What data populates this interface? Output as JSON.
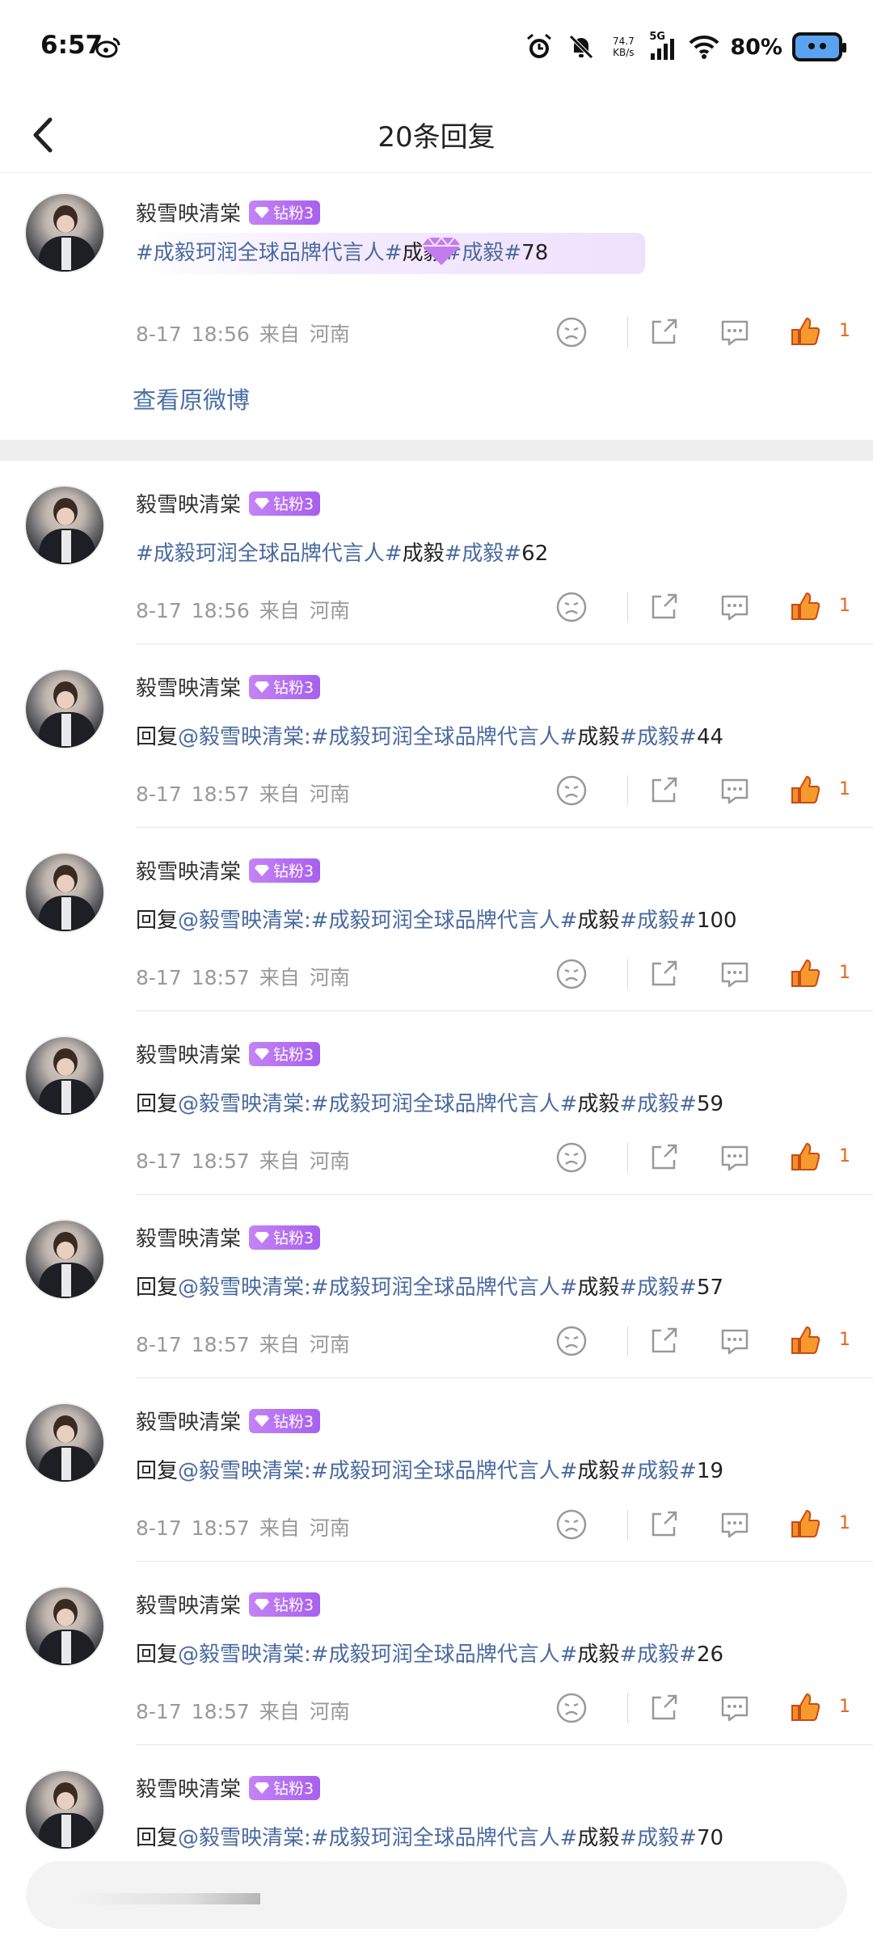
{
  "status_bar": {
    "time": "6:57",
    "net_speed_value": "74.7",
    "net_speed_unit": "KB/s",
    "network": "5G",
    "battery": "80%"
  },
  "header": {
    "title": "20条回复"
  },
  "original": {
    "user": "毅雪映清棠",
    "badge": "钻粉3",
    "tag1": "#成毅珂润全球品牌代言人#",
    "plain1": "成毅",
    "tag2": "#成毅#",
    "plain2": "78",
    "date": "8-17",
    "time": "18:56",
    "from": "来自",
    "location": "河南",
    "likes": "1",
    "view_original": "查看原微博"
  },
  "replies": [
    {
      "user": "毅雪映清棠",
      "badge": "钻粉3",
      "prefix": "",
      "mention": "",
      "tag1": "#成毅珂润全球品牌代言人#",
      "plain1": "成毅",
      "tag2": "#成毅#",
      "plain2": "62",
      "date": "8-17",
      "time": "18:56",
      "from": "来自",
      "location": "河南",
      "likes": "1"
    },
    {
      "user": "毅雪映清棠",
      "badge": "钻粉3",
      "prefix": "回复",
      "mention": "@毅雪映清棠:",
      "tag1": "#成毅珂润全球品牌代言人#",
      "plain1": "成毅",
      "tag2": "#成毅#",
      "plain2": "44",
      "date": "8-17",
      "time": "18:57",
      "from": "来自",
      "location": "河南",
      "likes": "1"
    },
    {
      "user": "毅雪映清棠",
      "badge": "钻粉3",
      "prefix": "回复",
      "mention": "@毅雪映清棠:",
      "tag1": "#成毅珂润全球品牌代言人#",
      "plain1": "成毅",
      "tag2": "#成毅#",
      "plain2": "100",
      "date": "8-17",
      "time": "18:57",
      "from": "来自",
      "location": "河南",
      "likes": "1"
    },
    {
      "user": "毅雪映清棠",
      "badge": "钻粉3",
      "prefix": "回复",
      "mention": "@毅雪映清棠:",
      "tag1": "#成毅珂润全球品牌代言人#",
      "plain1": "成毅",
      "tag2": "#成毅#",
      "plain2": "59",
      "date": "8-17",
      "time": "18:57",
      "from": "来自",
      "location": "河南",
      "likes": "1"
    },
    {
      "user": "毅雪映清棠",
      "badge": "钻粉3",
      "prefix": "回复",
      "mention": "@毅雪映清棠:",
      "tag1": "#成毅珂润全球品牌代言人#",
      "plain1": "成毅",
      "tag2": "#成毅#",
      "plain2": "57",
      "date": "8-17",
      "time": "18:57",
      "from": "来自",
      "location": "河南",
      "likes": "1"
    },
    {
      "user": "毅雪映清棠",
      "badge": "钻粉3",
      "prefix": "回复",
      "mention": "@毅雪映清棠:",
      "tag1": "#成毅珂润全球品牌代言人#",
      "plain1": "成毅",
      "tag2": "#成毅#",
      "plain2": "19",
      "date": "8-17",
      "time": "18:57",
      "from": "来自",
      "location": "河南",
      "likes": "1"
    },
    {
      "user": "毅雪映清棠",
      "badge": "钻粉3",
      "prefix": "回复",
      "mention": "@毅雪映清棠:",
      "tag1": "#成毅珂润全球品牌代言人#",
      "plain1": "成毅",
      "tag2": "#成毅#",
      "plain2": "26",
      "date": "8-17",
      "time": "18:57",
      "from": "来自",
      "location": "河南",
      "likes": "1"
    },
    {
      "user": "毅雪映清棠",
      "badge": "钻粉3",
      "prefix": "回复",
      "mention": "@毅雪映清棠:",
      "tag1": "#成毅珂润全球品牌代言人#",
      "plain1": "成毅",
      "tag2": "#成毅#",
      "plain2": "70",
      "date": "",
      "time": "",
      "from": "",
      "location": "",
      "likes": ""
    }
  ],
  "colors": {
    "link": "#4a6aa0",
    "like": "#e8631d",
    "badge": "#b072f1"
  }
}
